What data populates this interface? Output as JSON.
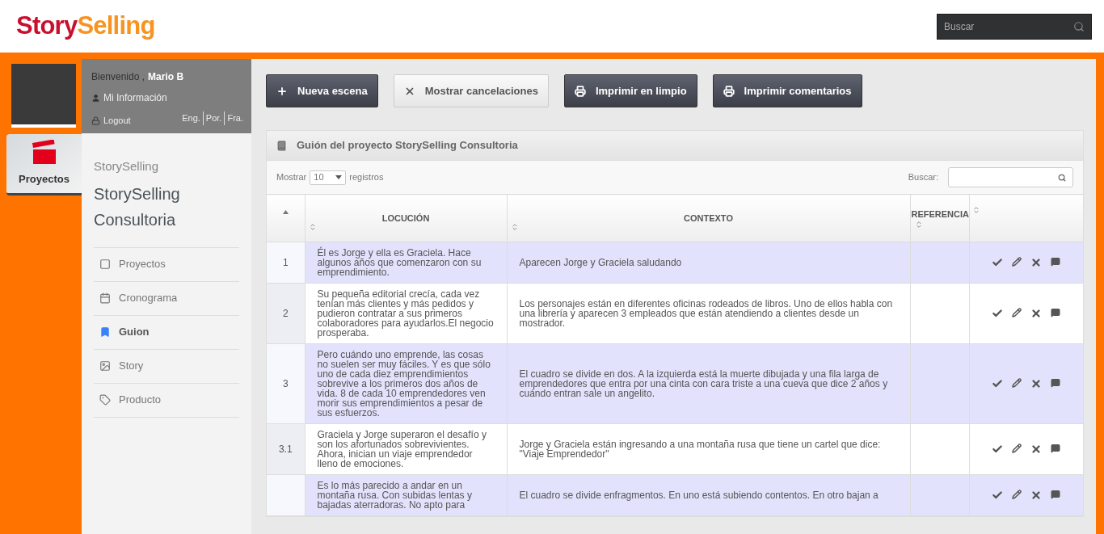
{
  "header": {
    "logo": [
      {
        "text": "Story",
        "color": "#c8102e"
      },
      {
        "text": "Selling",
        "color": "#f7931e"
      }
    ],
    "search": {
      "placeholder": "Buscar"
    }
  },
  "user": {
    "greeting": "Bienvenido ,",
    "name": "Mario B",
    "info_link": "Mi Información",
    "logout": "Logout",
    "languages": [
      "Eng.",
      "Por.",
      "Fra."
    ]
  },
  "left_tab": {
    "label": "Proyectos",
    "selected": true
  },
  "sidebar": {
    "subtitle": "StorySelling",
    "title": "StorySelling Consultoria",
    "items": [
      {
        "label": "Proyectos",
        "selected": false
      },
      {
        "label": "Cronograma",
        "selected": false
      },
      {
        "label": "Guion",
        "selected": true
      },
      {
        "label": "Story",
        "selected": false
      },
      {
        "label": "Producto",
        "selected": false
      }
    ]
  },
  "toolbar": [
    {
      "label": "Nueva escena",
      "kind": "add"
    },
    {
      "label": "Mostrar cancelaciones",
      "kind": "toggle"
    },
    {
      "label": "Imprimir en limpio",
      "kind": "print"
    },
    {
      "label": "Imprimir comentarios",
      "kind": "print"
    }
  ],
  "panel": {
    "title": "Guión del proyecto StorySelling Consultoria",
    "show_label": "Mostrar",
    "page_size": "10",
    "records_label": "registros",
    "search_label": "Buscar:"
  },
  "table": {
    "columns": [
      "LOCUCIÓN",
      "CONTEXTO",
      "REFERENCIA"
    ],
    "rows": [
      {
        "number": "1",
        "locucion": "Él es Jorge y ella es Graciela. Hace algunos años que comenzaron con su emprendimiento.",
        "contexto": "Aparecen Jorge y Graciela saludando",
        "referencia": ""
      },
      {
        "number": "2",
        "locucion": "Su pequeña editorial crecía, cada vez tenían más clientes y más pedidos y pudieron contratar a sus primeros colaboradores para ayudarlos.El negocio prosperaba.",
        "contexto": "Los personajes están en diferentes oficinas rodeados de libros. Uno de ellos habla con una librería y aparecen 3 empleados que están atendiendo a clientes desde un mostrador.",
        "referencia": ""
      },
      {
        "number": "3",
        "locucion": "Pero cuándo uno emprende, las cosas no suelen ser muy fáciles. Y es que sólo uno de cada diez emprendimientos sobrevive a los primeros dos años de vida. 8 de cada 10 emprendedores ven morir sus emprendimientos a pesar de sus esfuerzos.",
        "contexto": "El cuadro se divide en dos. A la izquierda está la muerte dibujada y una fila larga de emprendedores que entra por una cinta con cara triste a una cueva que dice 2 años y cuándo entran sale un angelito.",
        "referencia": ""
      },
      {
        "number": "3.1",
        "locucion": "Graciela y Jorge superaron el desafío y son los afortunados sobrevivientes. Ahora, inician un viaje emprendedor lleno de emociones.",
        "contexto": "Jorge y Graciela están ingresando a una montaña rusa que tiene un cartel que dice: \"Viaje Emprendedor\"",
        "referencia": ""
      },
      {
        "number": "",
        "locucion": "Es lo más parecido a andar en un montaña rusa. Con subidas lentas y bajadas aterradoras. No apto para",
        "contexto": "El cuadro se divide enfragmentos. En uno está subiendo contentos. En otro bajan a",
        "referencia": ""
      }
    ]
  }
}
